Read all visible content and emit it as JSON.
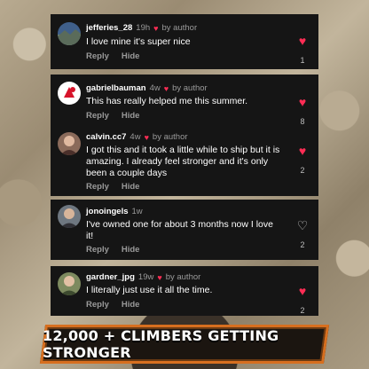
{
  "comments": [
    {
      "username": "jefferies_28",
      "time": "19h",
      "byline": "by author",
      "text": "I love mine it's super nice",
      "reply_label": "Reply",
      "hide_label": "Hide",
      "likes": "1",
      "liked": true,
      "avatar": "landscape-avatar"
    },
    {
      "username": "gabrielbauman",
      "time": "4w",
      "byline": "by author",
      "text": "This has really helped me this summer.",
      "reply_label": "Reply",
      "hide_label": "Hide",
      "likes": "8",
      "liked": true,
      "avatar": "red-logo-avatar"
    },
    {
      "username": "calvin.cc7",
      "time": "4w",
      "byline": "by author",
      "text": "I got this and it took a little while to ship but it is amazing. I already feel stronger and it's only been a couple days",
      "reply_label": "Reply",
      "hide_label": "Hide",
      "likes": "2",
      "liked": true,
      "avatar": "person-avatar"
    },
    {
      "username": "jonoingels",
      "time": "1w",
      "byline": "",
      "text": "I've owned one for about 3 months now I love it!",
      "reply_label": "Reply",
      "hide_label": "Hide",
      "likes": "2",
      "liked": false,
      "avatar": "person-avatar"
    },
    {
      "username": "gardner_jpg",
      "time": "19w",
      "byline": "by author",
      "text": "I literally just use it all the time.",
      "reply_label": "Reply",
      "hide_label": "Hide",
      "likes": "2",
      "liked": true,
      "avatar": "person-avatar"
    }
  ],
  "banner": {
    "text": "12,000 + CLIMBERS GETTING STRONGER"
  },
  "colors": {
    "card_bg": "#151515",
    "heart": "#ff2d55",
    "banner_border": "#d76f1f"
  }
}
